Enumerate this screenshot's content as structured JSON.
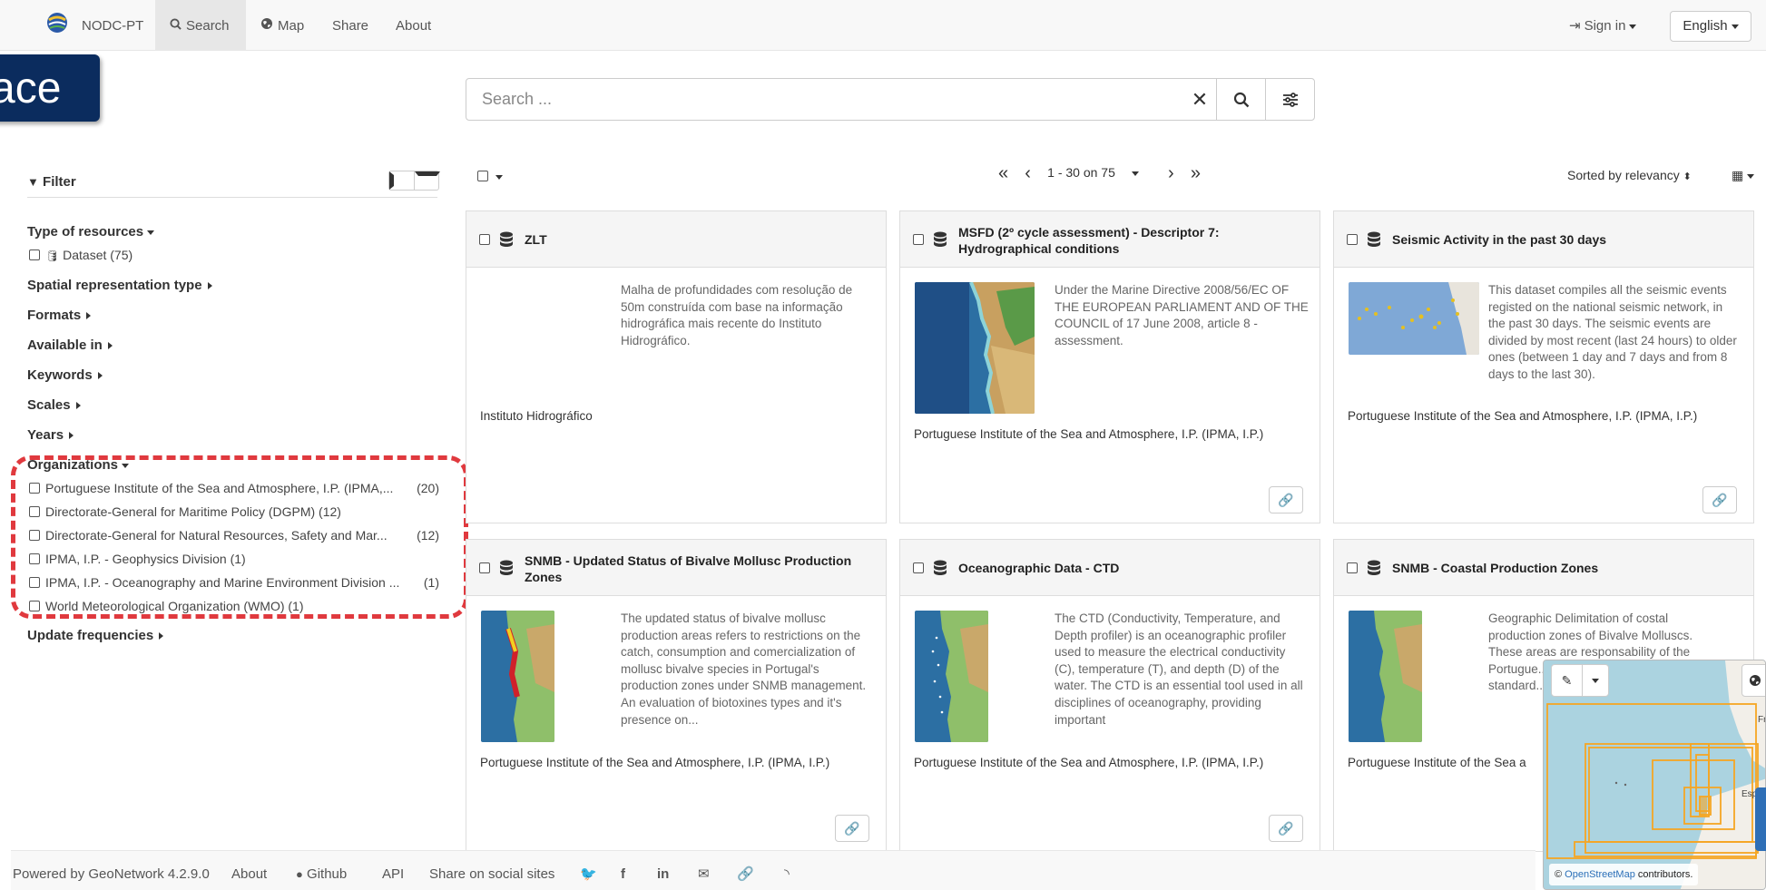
{
  "navbar": {
    "brand": "NODC-PT",
    "search": "Search",
    "map": "Map",
    "share": "Share",
    "about": "About",
    "sign_in": "Sign in",
    "language": "English"
  },
  "overlay_tag": "ace",
  "search": {
    "placeholder": "Search ...",
    "value": ""
  },
  "filter": {
    "title": "Filter",
    "facets": {
      "type_of_resources": "Type of resources",
      "dataset_item": "Dataset (75)",
      "spatial": "Spatial representation type",
      "formats": "Formats",
      "available": "Available in",
      "keywords": "Keywords",
      "scales": "Scales",
      "years": "Years",
      "organizations": "Organizations",
      "update_freq": "Update frequencies"
    },
    "organizations": [
      {
        "label": "Portuguese Institute of the Sea and Atmosphere, I.P. (IPMA,...",
        "count": "(20)"
      },
      {
        "label": "Directorate-General for Maritime Policy (DGPM) (12)",
        "count": ""
      },
      {
        "label": "Directorate-General for Natural Resources, Safety and Mar...",
        "count": "(12)"
      },
      {
        "label": "IPMA, I.P. - Geophysics Division (1)",
        "count": ""
      },
      {
        "label": "IPMA, I.P. - Oceanography and Marine Environment Division ...",
        "count": "(1)"
      },
      {
        "label": "World Meteorological Organization (WMO) (1)",
        "count": ""
      }
    ]
  },
  "results": {
    "pager": "1 - 30 on 75",
    "sort": "Sorted by relevancy",
    "cards": [
      {
        "title": "ZLT",
        "desc": "Malha de profundidades com resolução de 50m construída com base na informação hidrográfica mais recente do Instituto Hidrográfico.",
        "org": "Instituto Hidrográfico"
      },
      {
        "title": "MSFD (2º cycle assessment) - Descriptor 7: Hydrographical conditions",
        "desc": "Under the Marine Directive 2008/56/EC OF THE EUROPEAN PARLIAMENT AND OF THE COUNCIL of 17 June 2008, article 8 - assessment.",
        "org": "Portuguese Institute of the Sea and Atmosphere, I.P. (IPMA, I.P.)"
      },
      {
        "title": "Seismic Activity in the past 30 days",
        "desc": "This dataset compiles all the seismic events registed on the national seismic network, in the past 30 days. The seismic events are divided by most recent (last 24 hours) to older ones (between 1 day and 7 days and from 8 days to the last 30).",
        "org": "Portuguese Institute of the Sea and Atmosphere, I.P. (IPMA, I.P.)"
      },
      {
        "title": "SNMB - Updated Status of Bivalve Mollusc Production Zones",
        "desc": "The updated status of bivalve mollusc production areas refers to restrictions on the catch, consumption and comercialization of mollusc bivalve species in Portugal's production zones under SNMB management. An evaluation of biotoxines types and it's presence on...",
        "org": "Portuguese Institute of the Sea and Atmosphere, I.P. (IPMA, I.P.)"
      },
      {
        "title": "Oceanographic Data - CTD",
        "desc": "The CTD (Conductivity, Temperature, and Depth profiler) is an oceanographic profiler used to measure the electrical conductivity (C), temperature (T), and depth (D) of the water. The CTD is an essential tool used in all disciplines of oceanography, providing important",
        "org": "Portuguese Institute of the Sea and Atmosphere, I.P. (IPMA, I.P.)"
      },
      {
        "title": "SNMB - Coastal Production Zones",
        "desc": "Geographic Delimitation of costal production zones of Bivalve Molluscs. These areas are responsability of the Portugue... Monitorin... environm... standard...",
        "org": "Portuguese Institute of the Sea a"
      }
    ]
  },
  "map": {
    "attribution_link": "OpenStreetMap",
    "attribution_rest": " contributors.",
    "label_spain": "España",
    "label_fr": "Fr"
  },
  "footer": {
    "powered": "Powered by GeoNetwork 4.2.9.0",
    "about": "About",
    "github": "Github",
    "api": "API",
    "share": "Share on social sites"
  },
  "colors": {
    "accent": "#e0393e",
    "overlay": "#0b2c5e",
    "bbox": "#f5a623"
  }
}
